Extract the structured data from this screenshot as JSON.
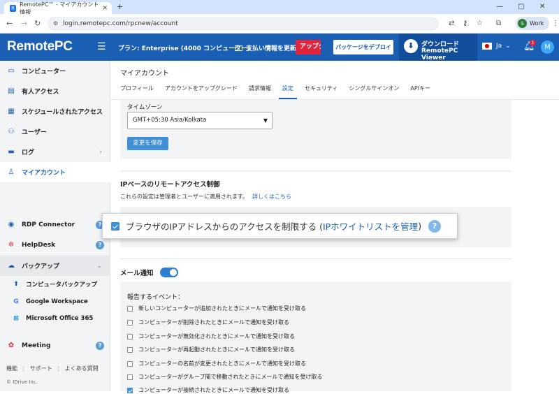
{
  "browser": {
    "tab_title": "RemotePC™ - マイアカウント情報",
    "url": "login.remotepc.com/rpcnew/account",
    "profile_name": "Work",
    "profile_initial": "S"
  },
  "header": {
    "logo": "RemotePC",
    "plan": "プラン: Enterprise (4000 コンピューター)",
    "update_label": "支払い情報を更新",
    "upgrade_label": "アップグレード",
    "deploy_label": "パッケージをデプロイ",
    "download_line1": "ダウンロード",
    "download_line2": "RemotePC Viewer",
    "language": "Ja",
    "notification_count": "1",
    "user_initial": "M"
  },
  "sidebar": {
    "items": [
      {
        "label": "コンピューター"
      },
      {
        "label": "有人アクセス"
      },
      {
        "label": "スケジュールされたアクセス"
      },
      {
        "label": "ユーザー"
      },
      {
        "label": "ログ"
      },
      {
        "label": "マイアカウント"
      },
      {
        "label": "RDP Connector"
      },
      {
        "label": "HelpDesk"
      },
      {
        "label": "バックアップ"
      },
      {
        "label": "Meeting"
      }
    ],
    "backup_sub": [
      {
        "label": "コンピュータバックアップ"
      },
      {
        "label": "Google Workspace"
      },
      {
        "label": "Microsoft Office 365"
      }
    ],
    "footer": {
      "faq": "機能",
      "support": "サポート",
      "questions": "よくある質問",
      "copyright": "© IDrive Inc."
    }
  },
  "main": {
    "title": "マイアカウント",
    "tabs": [
      {
        "label": "プロフィール"
      },
      {
        "label": "アカウントをアップグレード"
      },
      {
        "label": "請求情報"
      },
      {
        "label": "設定"
      },
      {
        "label": "セキュリティ"
      },
      {
        "label": "シングルサインオン"
      },
      {
        "label": "APIキー"
      }
    ],
    "timezone": {
      "label": "タイムゾーン",
      "value": "GMT+05:30 Asia/Kolkata",
      "save": "変更を保存"
    },
    "ip": {
      "heading": "IPベースのリモートアクセス制御",
      "desc": "これらの設定は管理者とユーザーに適用されます。",
      "learn_more": "詳しくはこちら",
      "checkbox_label": "ブラウザのIPアドレスからのアクセスを制限する (",
      "whitelist_link": "IPホワイトリストを管理",
      "checkbox_close": ")"
    },
    "email": {
      "heading": "メール通知",
      "events_label": "報告するイベント：",
      "events": [
        {
          "label": "新しいコンピューターが追加されたときにメールで通知を受け取る",
          "checked": false
        },
        {
          "label": "コンピューターが削除されたときにメールで通知を受け取る",
          "checked": false
        },
        {
          "label": "コンピューターが無効化されたときにメールで通知を受け取る",
          "checked": false
        },
        {
          "label": "コンピューターが再起動されたときにメールで通知を受け取る",
          "checked": false
        },
        {
          "label": "コンピューターの名前が変更されたときにメールで通知を受け取る",
          "checked": false
        },
        {
          "label": "コンピューターがグループ間で移動されたときにメールで通知を受け取る",
          "checked": false
        },
        {
          "label": "コンピューターが接続されたときにメールで通知を受け取る",
          "checked": true
        }
      ]
    }
  }
}
